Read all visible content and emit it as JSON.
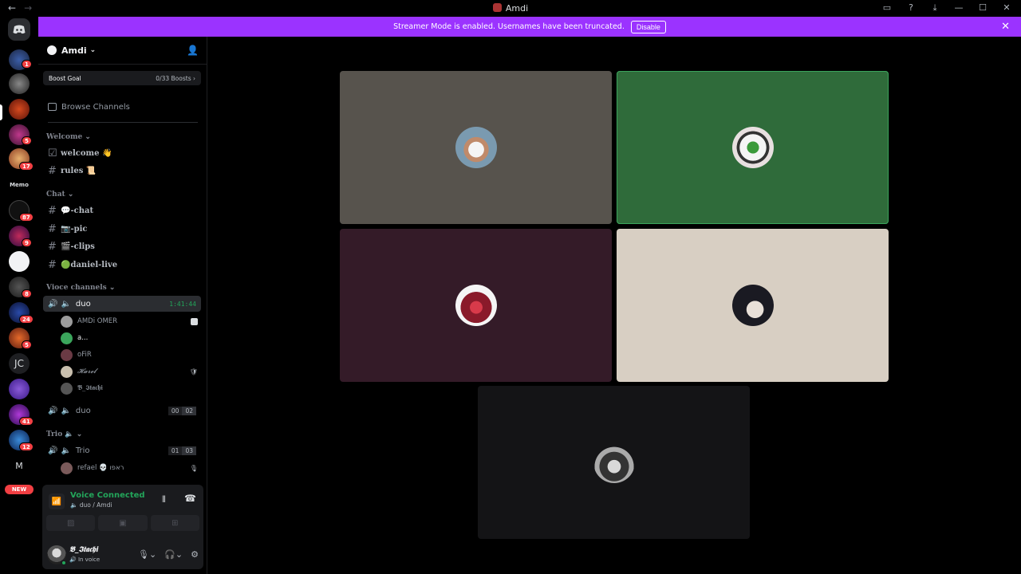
{
  "titlebar": {
    "title": "Amdi",
    "back": "←",
    "forward": "→",
    "icons": [
      "inbox-icon",
      "help-icon",
      "download-icon",
      "minimize-icon",
      "maximize-icon",
      "close-icon"
    ]
  },
  "banner": {
    "message": "Streamer Mode is enabled. Usernames have been truncated.",
    "button": "Disable",
    "color": "#9b33ff"
  },
  "servers": {
    "badges": [
      "1",
      "5",
      "17",
      "87",
      "9",
      "8",
      "24",
      "5",
      "41",
      "12"
    ],
    "initials": "JC",
    "letter": "M",
    "new_label": "NEW"
  },
  "guild": {
    "name": "Amdi",
    "boost_label": "Boost Goal",
    "boost_value": "0/33 Boosts",
    "browse": "Browse Channels"
  },
  "categories": {
    "welcome": "Welcome",
    "chat": "Chat",
    "voice": "Vioce channels",
    "trio": "Trio"
  },
  "channels": {
    "welcome": "welcome 👋",
    "rules": "rules 📜",
    "chat": "💬-chat",
    "pic": "📷-pic",
    "clips": "🎬-clips",
    "live": "🟢daniel-live"
  },
  "voice": {
    "duo_active": "duo",
    "duo_timer": "1:41:44",
    "members": [
      {
        "name": "AMDi OMER",
        "color": "#9c9c9c"
      },
      {
        "name": "a...",
        "color": "#3ba55c"
      },
      {
        "name": "oFiR",
        "color": "#6a3a44"
      },
      {
        "name": "𝓗𝓪𝓻𝓮𝓵",
        "color": "#c9bfae"
      },
      {
        "name": "𝕭_𝕴𝖙𝖆𝖈𝖍𝖎",
        "color": "#555"
      }
    ],
    "duo2": "duo",
    "duo2_counts": [
      "00",
      "02"
    ],
    "trio": "Trio",
    "trio_counts": [
      "01",
      "03"
    ],
    "trio_member": "refael 💀 ראפו"
  },
  "voice_panel": {
    "status": "Voice Connected",
    "location": "duo / Amdi"
  },
  "user": {
    "name": "𝕭_𝕴𝖙𝖆𝖈𝖍𝖎",
    "status": "In voice"
  },
  "tiles": [
    {
      "bg": "#57534d",
      "avatar": "player-avatar",
      "speaking": false
    },
    {
      "bg": "#2f6b3a",
      "avatar": "plate-avatar",
      "speaking": true
    },
    {
      "bg": "#341b28",
      "avatar": "hero-avatar",
      "speaking": false
    },
    {
      "bg": "#d8cfc3",
      "avatar": "anime-avatar",
      "speaking": false
    },
    {
      "bg": "#141416",
      "avatar": "itachi-avatar",
      "speaking": false
    }
  ]
}
